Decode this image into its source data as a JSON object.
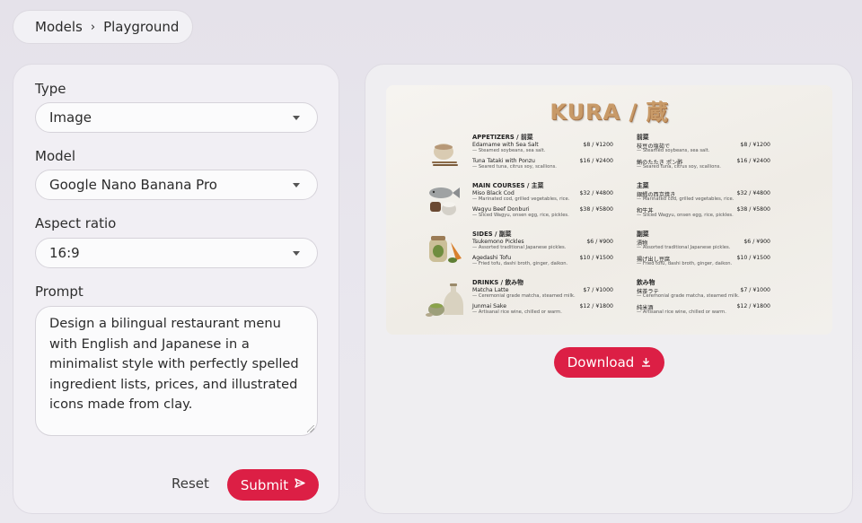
{
  "breadcrumb": {
    "items": [
      "Models",
      "Playground"
    ],
    "separator": "›"
  },
  "form": {
    "type_label": "Type",
    "type_value": "Image",
    "model_label": "Model",
    "model_value": "Google Nano Banana Pro",
    "aspect_label": "Aspect ratio",
    "aspect_value": "16:9",
    "prompt_label": "Prompt",
    "prompt_value": "Design a bilingual restaurant menu with English and Japanese in a minimalist style with perfectly spelled ingredient lists, prices, and illustrated icons made from clay.",
    "reset_label": "Reset",
    "submit_label": "Submit"
  },
  "output": {
    "download_label": "Download",
    "menu": {
      "title": "KURA / 蔵",
      "sections": [
        {
          "en_head": "APPETIZERS / 前菜",
          "jp_head": "前菜",
          "icon": "clay-bowl-chopsticks-icon",
          "items": [
            {
              "en": "Edamame with Sea Salt",
              "en_desc": "— Steamed soybeans, sea salt.",
              "jp": "枝豆の塩茹で",
              "jp_desc": "— Steamed soybeans, sea salt.",
              "price": "$8 / ¥1200"
            },
            {
              "en": "Tuna Tataki with Ponzu",
              "en_desc": "— Seared tuna, citrus soy, scallions.",
              "jp": "鮪のたたき ポン酢",
              "jp_desc": "— Seared tuna, citrus soy, scallions.",
              "price": "$16 / ¥2400"
            }
          ]
        },
        {
          "en_head": "MAIN COURSES / 主菜",
          "jp_head": "主菜",
          "icon": "clay-fish-rice-icon",
          "items": [
            {
              "en": "Miso Black Cod",
              "en_desc": "— Marinated cod, grilled vegetables, rice.",
              "jp": "銀鱈の西京焼き",
              "jp_desc": "— Marinated cod, grilled vegetables, rice.",
              "price": "$32 / ¥4800"
            },
            {
              "en": "Wagyu Beef Donburi",
              "en_desc": "— Sliced Wagyu, onsen egg, rice, pickles.",
              "jp": "和牛丼",
              "jp_desc": "— Sliced Wagyu, onsen egg, rice, pickles.",
              "price": "$38 / ¥5800"
            }
          ]
        },
        {
          "en_head": "SIDES / 副菜",
          "jp_head": "副菜",
          "icon": "clay-pickle-jar-icon",
          "items": [
            {
              "en": "Tsukemono Pickles",
              "en_desc": "— Assorted traditional Japanese pickles.",
              "jp": "漬物",
              "jp_desc": "— Assorted traditional Japanese pickles.",
              "price": "$6 / ¥900"
            },
            {
              "en": "Agedashi Tofu",
              "en_desc": "— Fried tofu, dashi broth, ginger, daikon.",
              "jp": "揚げ出し豆腐",
              "jp_desc": "— Fried tofu, dashi broth, ginger, daikon.",
              "price": "$10 / ¥1500"
            }
          ]
        },
        {
          "en_head": "DRINKS / 飲み物",
          "jp_head": "飲み物",
          "icon": "clay-sake-bottle-icon",
          "items": [
            {
              "en": "Matcha Latte",
              "en_desc": "— Ceremonial grade matcha, steamed milk.",
              "jp": "抹茶ラテ",
              "jp_desc": "— Ceremonial grade matcha, steamed milk.",
              "price": "$7 / ¥1000"
            },
            {
              "en": "Junmai Sake",
              "en_desc": "— Artisanal rice wine, chilled or warm.",
              "jp": "純米酒",
              "jp_desc": "— Artisanal rice wine, chilled or warm.",
              "price": "$12 / ¥1800"
            }
          ]
        }
      ]
    }
  },
  "colors": {
    "accent": "#dc1f45",
    "menu_title": "#c89a68"
  }
}
